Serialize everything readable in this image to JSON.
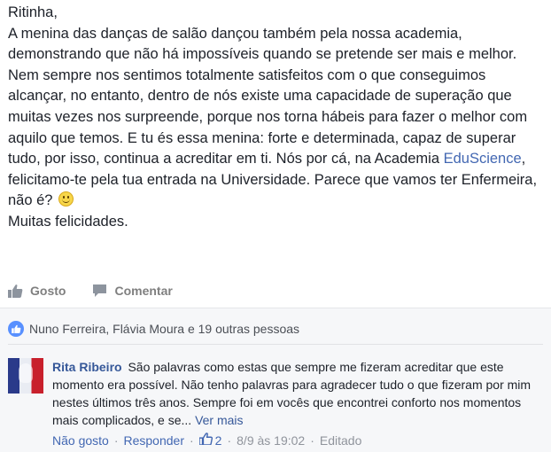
{
  "post": {
    "greeting": "Ritinha,",
    "paragraph1": "A menina das danças de salão dançou também pela nossa academia, demonstrando que não há impossíveis quando se pretende ser mais e melhor.",
    "paragraph2_before_link": "Nem sempre nos sentimos totalmente satisfeitos com o que conseguimos alcançar, no entanto, dentro de nós existe uma capacidade de superação que muitas vezes nos surpreende, porque nos torna hábeis para fazer o melhor com aquilo que temos. E tu és essa menina: forte e determinada, capaz de superar tudo, por isso, continua a acreditar em ti. Nós por cá, na Academia ",
    "link_text": "EduScience",
    "paragraph2_after_link": ", felicitamo-te pela tua entrada na Universidade. Parece que vamos ter Enfermeira, não é? ",
    "closing": "Muitas felicidades."
  },
  "actions": {
    "like_label": "Gosto",
    "comment_label": "Comentar"
  },
  "reactions": {
    "summary": "Nuno Ferreira, Flávia Moura e 19 outras pessoas"
  },
  "comment": {
    "author": "Rita Ribeiro",
    "text": "São palavras como estas que sempre me fizeram acreditar que este momento era possível. Não tenho palavras para agradecer tudo o que fizeram por mim nestes últimos três anos. Sempre foi em vocês que encontrei conforto nos momentos mais complicados, e se...",
    "see_more": "Ver mais",
    "unlike_label": "Não gosto",
    "reply_label": "Responder",
    "like_count": "2",
    "timestamp": "8/9 às 19:02",
    "edited_label": "Editado"
  }
}
